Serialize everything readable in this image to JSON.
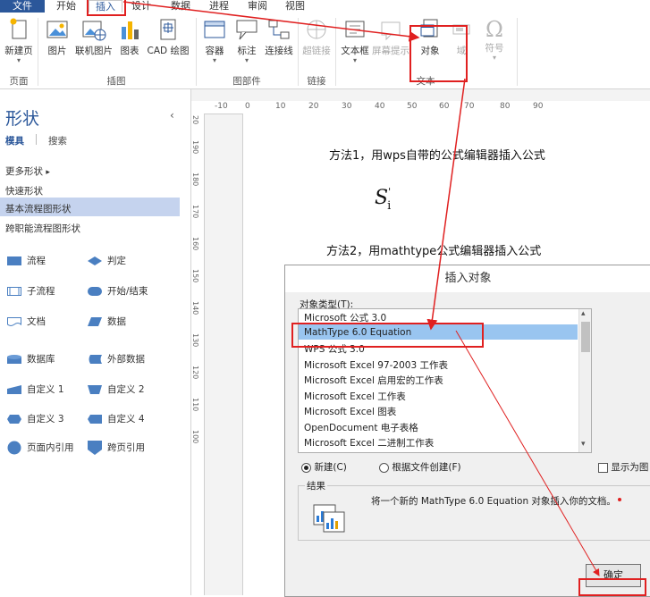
{
  "ribbon_tabs": [
    "文件",
    "开始",
    "插入",
    "设计",
    "数据",
    "进程",
    "审阅",
    "视图"
  ],
  "ribbon": {
    "buttons": {
      "new_page": "新建页",
      "picture": "图片",
      "online_picture": "联机图片",
      "chart": "图表",
      "cad": "CAD 绘图",
      "container": "容器",
      "callout": "标注",
      "connector": "连接线",
      "hyperlink": "超链接",
      "screentip": "屏幕提示",
      "textbox": "文本框",
      "object": "对象",
      "field": "域",
      "symbol": "符号"
    },
    "groups": {
      "pages": "页面",
      "illustrations": "插图",
      "diagram_parts": "图部件",
      "links": "链接",
      "text": "文本"
    }
  },
  "shapes_pane": {
    "title": "形状",
    "tabs": [
      "模具",
      "搜索"
    ],
    "links": [
      "更多形状",
      "快速形状",
      "基本流程图形状",
      "跨职能流程图形状"
    ],
    "selected_link": "基本流程图形状",
    "shapes": [
      [
        "流程",
        "判定"
      ],
      [
        "子流程",
        "开始/结束"
      ],
      [
        "文档",
        "数据"
      ],
      [
        "数据库",
        "外部数据"
      ],
      [
        "自定义 1",
        "自定义 2"
      ],
      [
        "自定义 3",
        "自定义 4"
      ],
      [
        "页面内引用",
        "跨页引用"
      ]
    ]
  },
  "ruler": {
    "horizontal": [
      "-10",
      "0",
      "10",
      "20",
      "30",
      "40",
      "50",
      "60",
      "70",
      "80",
      "90"
    ],
    "vertical": [
      "20",
      "190",
      "180",
      "170",
      "160",
      "150",
      "140",
      "130",
      "120",
      "110",
      "100"
    ]
  },
  "document": {
    "line1": "方法1，用wps自带的公式编辑器插入公式",
    "formula_base": "S",
    "formula_sup": "'",
    "formula_sub": "i",
    "line2": "方法2，用mathtype公式编辑器插入公式"
  },
  "dialog": {
    "title": "插入对象",
    "type_label": "对象类型(T):",
    "items": [
      "Microsoft 公式 3.0",
      "MathType 6.0 Equation",
      "WPS 公式 3.0",
      "Microsoft Excel 97-2003 工作表",
      "Microsoft Excel 启用宏的工作表",
      "Microsoft Excel 工作表",
      "Microsoft Excel 图表",
      "OpenDocument 电子表格",
      "Microsoft Excel 二进制工作表"
    ],
    "selected_index": 1,
    "radio_new": "新建(C)",
    "radio_from_file": "根据文件创建(F)",
    "display_as_icon": "显示为图",
    "result_label": "结果",
    "result_text": "将一个新的 MathType 6.0 Equation 对象插入你的文档。",
    "ok": "确定"
  },
  "colors": {
    "file_tab": "#2b579a",
    "selection": "#99c5f0",
    "annotation": "#e02020",
    "pane_selected": "#c5d3ee"
  }
}
